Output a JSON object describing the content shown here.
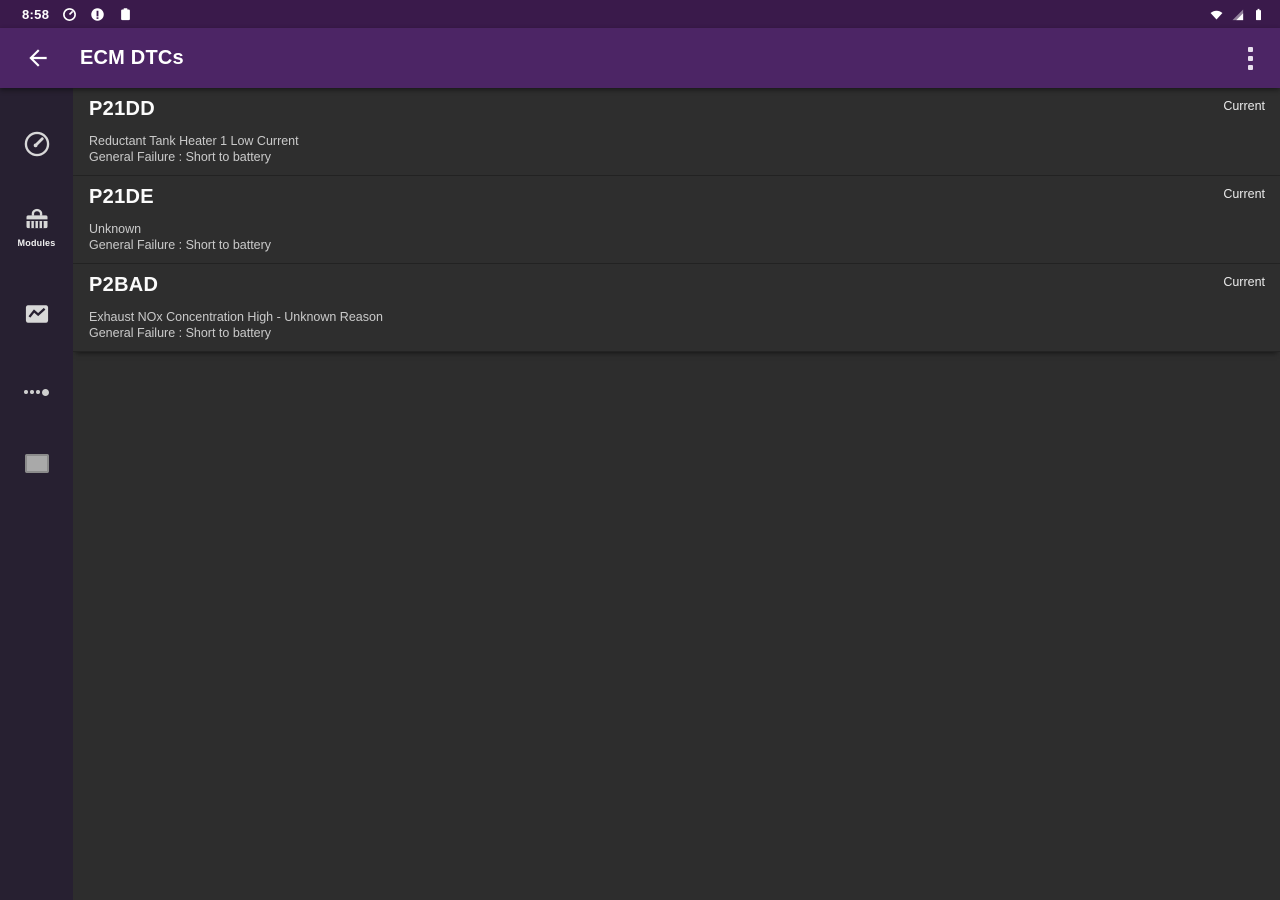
{
  "status_bar": {
    "time": "8:58",
    "left_icons": [
      "gauge-icon",
      "notification-circle-icon",
      "clipboard-icon"
    ],
    "right_icons": [
      "wifi-icon",
      "cell-signal-icon",
      "battery-icon"
    ]
  },
  "app_bar": {
    "title": "ECM DTCs",
    "back_icon": "arrow-left-icon",
    "menu_icon": "overflow-menu-icon"
  },
  "sidebar": {
    "items": [
      {
        "icon": "speedometer-icon",
        "label": ""
      },
      {
        "icon": "toolbox-icon",
        "label": "Modules"
      },
      {
        "icon": "graph-icon",
        "label": ""
      },
      {
        "icon": "dots-icon",
        "label": ""
      },
      {
        "icon": "square-icon",
        "label": ""
      }
    ]
  },
  "dtc_list": [
    {
      "code": "P21DD",
      "description": "Reductant Tank Heater 1 Low Current",
      "detail": "General Failure : Short to battery",
      "status": "Current"
    },
    {
      "code": "P21DE",
      "description": "Unknown",
      "detail": "General Failure : Short to battery",
      "status": "Current"
    },
    {
      "code": "P2BAD",
      "description": "Exhaust NOx Concentration High - Unknown Reason",
      "detail": "General Failure : Short to battery",
      "status": "Current"
    }
  ],
  "colors": {
    "status_bar_bg": "#3a1a4b",
    "app_bar_bg": "#4c2565",
    "sidebar_bg": "#272031",
    "content_bg": "#2d2d2d",
    "title_text": "#fbfbfb",
    "subtitle_text": "#c9c9c9"
  }
}
